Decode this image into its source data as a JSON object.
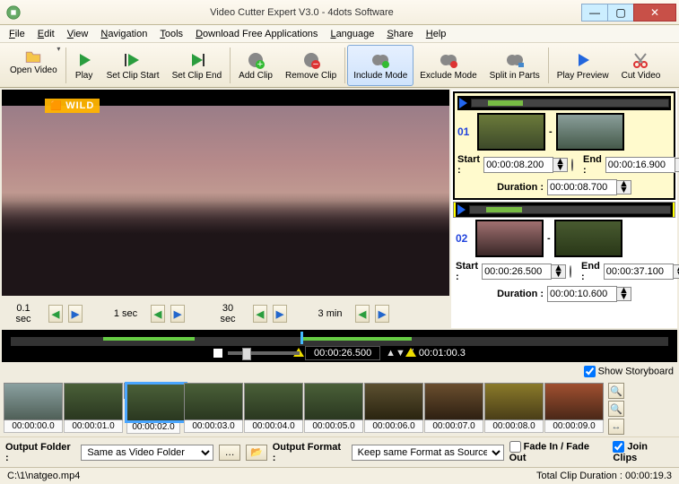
{
  "titlebar": {
    "title": "Video Cutter Expert V3.0 - 4dots Software"
  },
  "menu": [
    "File",
    "Edit",
    "View",
    "Navigation",
    "Tools",
    "Download Free Applications",
    "Language",
    "Share",
    "Help"
  ],
  "toolbar": [
    {
      "name": "open-video",
      "label": "Open Video",
      "dd": true
    },
    {
      "name": "play",
      "label": "Play"
    },
    {
      "name": "set-clip-start",
      "label": "Set Clip Start"
    },
    {
      "name": "set-clip-end",
      "label": "Set Clip End"
    },
    {
      "name": "add-clip",
      "label": "Add Clip"
    },
    {
      "name": "remove-clip",
      "label": "Remove Clip"
    },
    {
      "name": "include-mode",
      "label": "Include Mode",
      "active": true
    },
    {
      "name": "exclude-mode",
      "label": "Exclude Mode"
    },
    {
      "name": "split-in-parts",
      "label": "Split in Parts"
    },
    {
      "name": "play-preview",
      "label": "Play Preview"
    },
    {
      "name": "cut-video",
      "label": "Cut Video"
    }
  ],
  "wild_badge": "WILD",
  "seek_steps": [
    "0.1 sec",
    "1 sec",
    "30 sec",
    "3 min"
  ],
  "clips": [
    {
      "num": "01",
      "start": "00:00:08.200",
      "end": "00:00:16.900",
      "duration": "00:00:08.700",
      "sel": false
    },
    {
      "num": "02",
      "start": "00:00:26.500",
      "end": "00:00:37.100",
      "duration": "00:00:10.600",
      "sel": true
    }
  ],
  "labels": {
    "start": "Start  :",
    "end": "End  :",
    "duration": "Duration  :"
  },
  "timeline": {
    "current": "00:00:26.500",
    "total": "00:01:00.3"
  },
  "show_storyboard": "Show Storyboard",
  "story": [
    "00:00:00.0",
    "00:00:01.0",
    "00:00:02.0",
    "00:00:03.0",
    "00:00:04.0",
    "00:00:05.0",
    "00:00:06.0",
    "00:00:07.0",
    "00:00:08.0",
    "00:00:09.0"
  ],
  "story_sel_index": 2,
  "output": {
    "folder_label": "Output Folder :",
    "folder": "Same as Video Folder",
    "format_label": "Output Format :",
    "format": "Keep same Format as Source",
    "fade": "Fade In / Fade Out",
    "join": "Join Clips"
  },
  "status": {
    "path": "C:\\1\\natgeo.mp4",
    "total": "Total Clip Duration : 00:00:19.3"
  }
}
